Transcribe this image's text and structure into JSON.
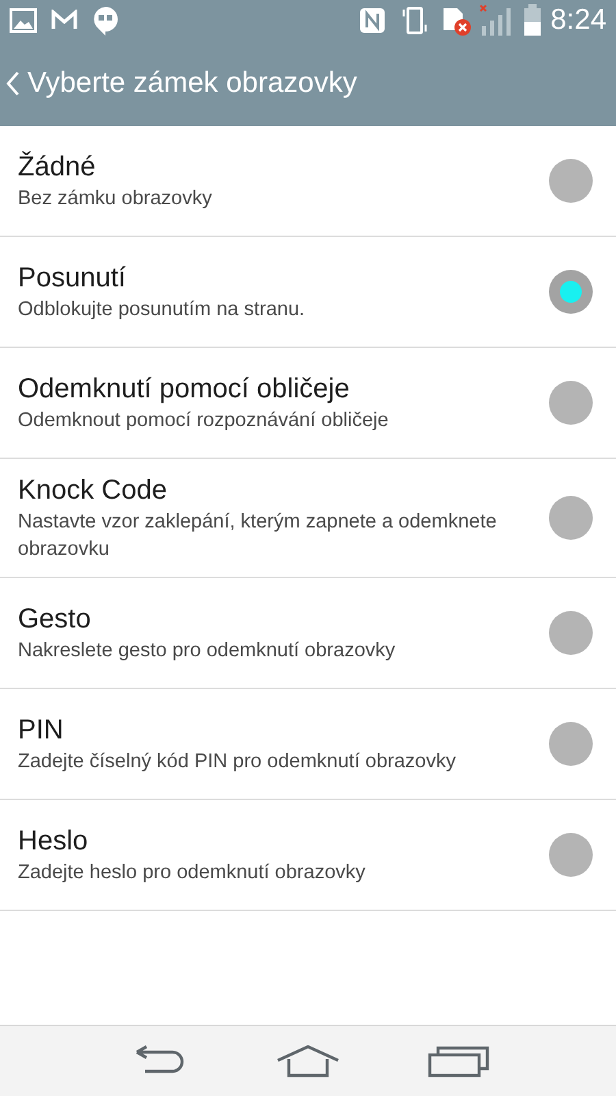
{
  "status_bar": {
    "time": "8:24"
  },
  "app_bar": {
    "title": "Vyberte zámek obrazovky"
  },
  "options": [
    {
      "title": "Žádné",
      "subtitle": "Bez zámku obrazovky",
      "selected": false
    },
    {
      "title": "Posunutí",
      "subtitle": "Odblokujte posunutím na stranu.",
      "selected": true
    },
    {
      "title": "Odemknutí pomocí obličeje",
      "subtitle": "Odemknout pomocí rozpoznávání obličeje",
      "selected": false
    },
    {
      "title": "Knock Code",
      "subtitle": "Nastavte vzor zaklepání, kterým zapnete a odemknete obrazovku",
      "selected": false
    },
    {
      "title": "Gesto",
      "subtitle": "Nakreslete gesto pro odemknutí obrazovky",
      "selected": false
    },
    {
      "title": "PIN",
      "subtitle": "Zadejte číselný kód PIN pro odemknutí obrazovky",
      "selected": false
    },
    {
      "title": "Heslo",
      "subtitle": "Zadejte heslo pro odemknutí obrazovky",
      "selected": false
    }
  ]
}
